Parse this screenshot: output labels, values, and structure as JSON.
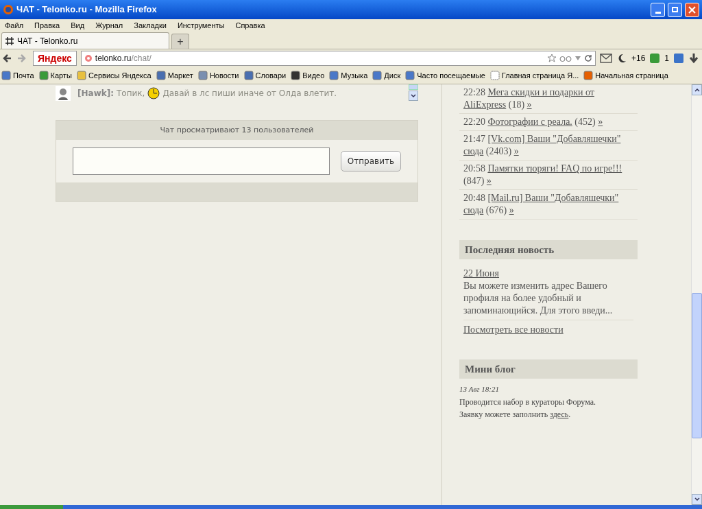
{
  "window": {
    "title": "ЧАТ - Telonko.ru - Mozilla Firefox"
  },
  "menu": [
    "Файл",
    "Правка",
    "Вид",
    "Журнал",
    "Закладки",
    "Инструменты",
    "Справка"
  ],
  "tabs": [
    {
      "label": "ЧАТ - Telonko.ru",
      "selected": true
    }
  ],
  "new_tab": "+",
  "navbar": {
    "search_logo": "Яндекс",
    "address_domain": "telonko.ru",
    "address_path": "/chat/",
    "weather": "+16",
    "counter": "1"
  },
  "bookmarks": [
    "Почта",
    "Карты",
    "Сервисы Яндекса",
    "Маркет",
    "Новости",
    "Словари",
    "Видео",
    "Музыка",
    "Диск",
    "Часто посещаемые",
    "Главная страница Я...",
    "Начальная страница"
  ],
  "chat": {
    "message": {
      "user": "[Hawk]:",
      "before": "Топик,",
      "after": "Давай в лс пиши иначе от Олда влетит."
    },
    "viewers": "Чат просматривают 13 пользователей",
    "send_button": "Отправить"
  },
  "topics": [
    {
      "time": "22:28",
      "title": "Мега скидки и подарки от AliExpress",
      "count": "(18)",
      "more": "»"
    },
    {
      "time": "22:20",
      "title": "Фотографии с реала.",
      "count": "(452)",
      "more": "»"
    },
    {
      "time": "21:47",
      "title": "[Vk.com] Ваши \"Добавляшечки\" сюда",
      "count": "(2403)",
      "more": "»"
    },
    {
      "time": "20:58",
      "title": "Памятки тюряги! FAQ по игре!!!",
      "count": "(847)",
      "more": "»"
    },
    {
      "time": "20:48",
      "title": "[Mail.ru] Ваши \"Добавляшечки\" сюда",
      "count": "(676)",
      "more": "»"
    }
  ],
  "news": {
    "heading": "Последняя новость",
    "date": "22 Июня",
    "text": "Вы можете изменить адрес Вашего профиля на более удобный и запоминающийся. Для этого введи...",
    "all_link": "Посмотреть все новости"
  },
  "blog": {
    "heading": "Мини блог",
    "date": "13 Авг 18:21",
    "line1": "Проводится набор в кураторы Форума.",
    "line2": "Заявку можете заполнить",
    "link": "здесь",
    "end": "."
  }
}
